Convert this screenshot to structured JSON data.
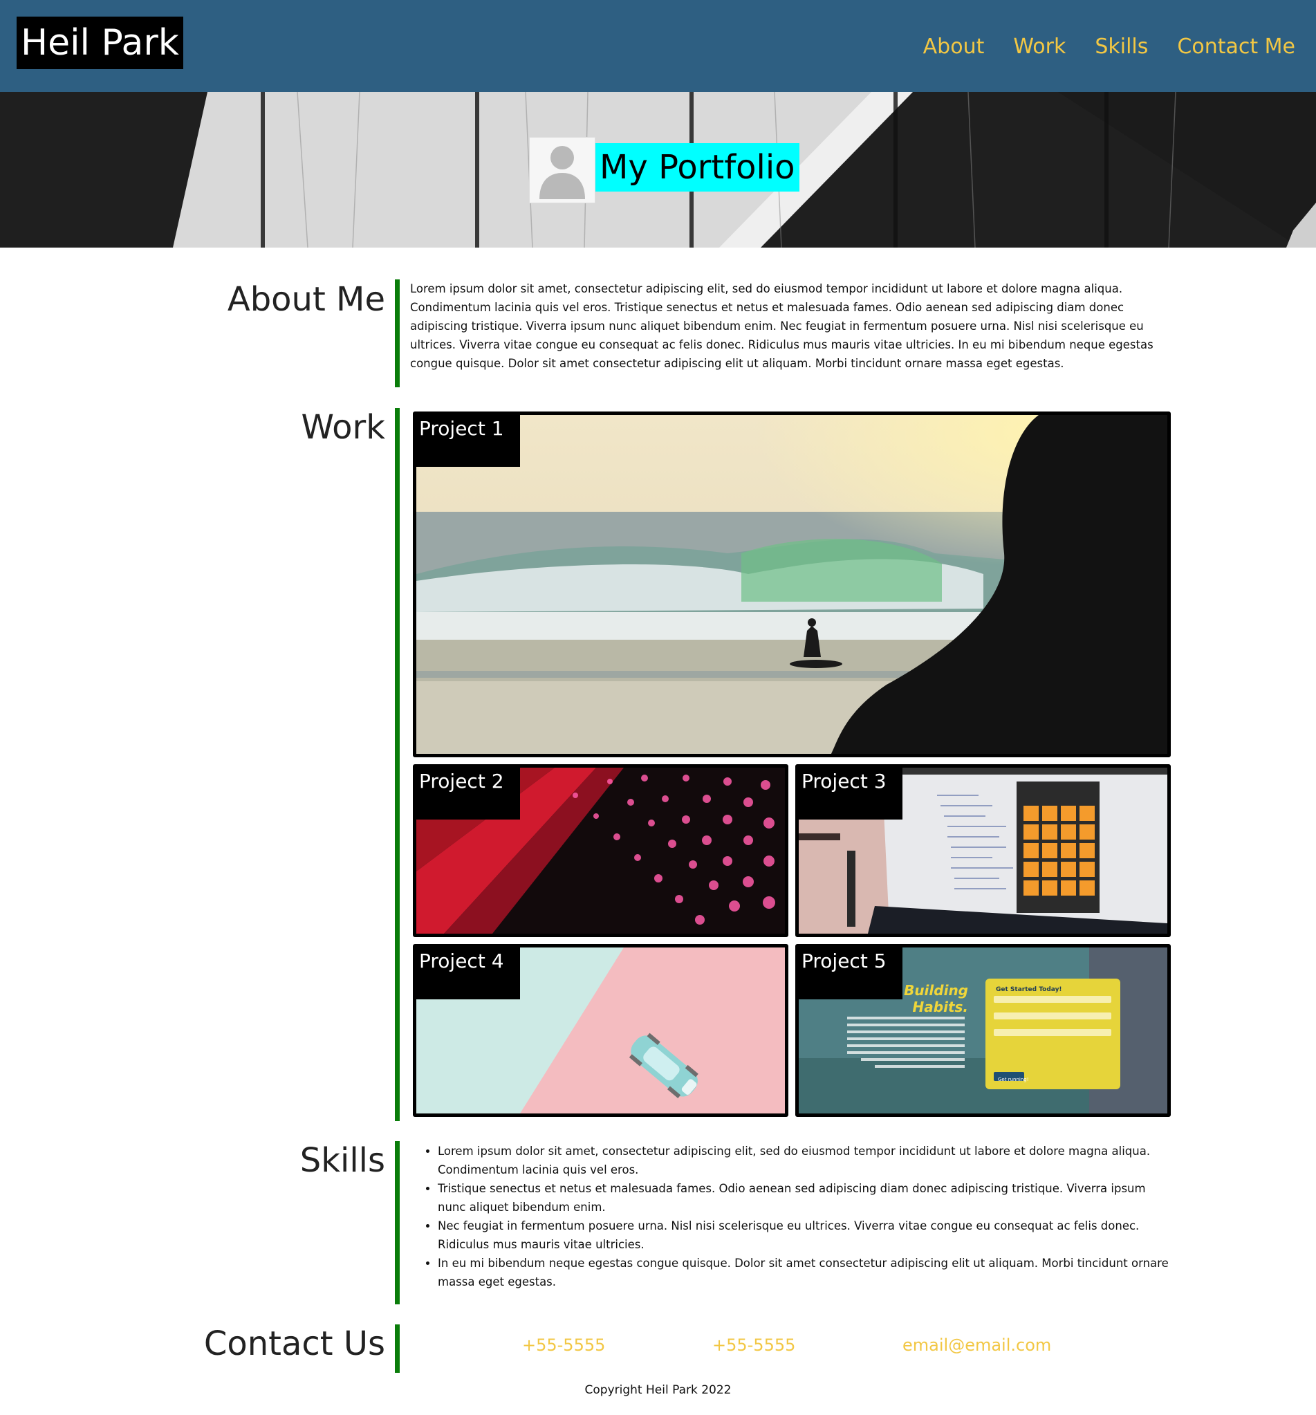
{
  "header": {
    "brand": "Heil Park",
    "nav": [
      "About",
      "Work",
      "Skills",
      "Contact Me"
    ]
  },
  "hero": {
    "title": "My Portfolio",
    "avatar_icon": "user-silhouette-icon"
  },
  "about": {
    "title": "About Me",
    "text": "Lorem ipsum dolor sit amet, consectetur adipiscing elit, sed do eiusmod tempor incididunt ut labore et dolore magna aliqua. Condimentum lacinia quis vel eros. Tristique senectus et netus et malesuada fames. Odio aenean sed adipiscing diam donec adipiscing tristique. Viverra ipsum nunc aliquet bibendum enim. Nec feugiat in fermentum posuere urna. Nisl nisi scelerisque eu ultrices. Viverra vitae congue eu consequat ac felis donec. Ridiculus mus mauris vitae ultricies. In eu mi bibendum neque egestas congue quisque. Dolor sit amet consectetur adipiscing elit ut aliquam. Morbi tincidunt ornare massa eget egestas."
  },
  "work": {
    "title": "Work",
    "projects": [
      {
        "label": "Project 1"
      },
      {
        "label": "Project 2"
      },
      {
        "label": "Project 3"
      },
      {
        "label": "Project 4"
      },
      {
        "label": "Project 5"
      }
    ],
    "project5_text": {
      "headline_1": "Building",
      "headline_2": "Habits.",
      "form_title": "Get Started Today!",
      "submit": "Get running!"
    }
  },
  "skills": {
    "title": "Skills",
    "items": [
      "Lorem ipsum dolor sit amet, consectetur adipiscing elit, sed do eiusmod tempor incididunt ut labore et dolore magna aliqua. Condimentum lacinia quis vel eros.",
      "Tristique senectus et netus et malesuada fames. Odio aenean sed adipiscing diam donec adipiscing tristique. Viverra ipsum nunc aliquet bibendum enim.",
      "Nec feugiat in fermentum posuere urna. Nisl nisi scelerisque eu ultrices. Viverra vitae congue eu consequat ac felis donec. Ridiculus mus mauris vitae ultricies.",
      "In eu mi bibendum neque egestas congue quisque. Dolor sit amet consectetur adipiscing elit ut aliquam. Morbi tincidunt ornare massa eget egestas."
    ]
  },
  "contact": {
    "title": "Contact Us",
    "phone_1": "+55-5555",
    "phone_2": "+55-5555",
    "email": "email@email.com"
  },
  "footer": {
    "copyright": "Copyright Heil Park 2022"
  },
  "colors": {
    "header_bg": "#2e5f82",
    "nav_link": "#f2c744",
    "accent_line": "#0a7d0a",
    "hero_title_bg": "#00ffff"
  }
}
